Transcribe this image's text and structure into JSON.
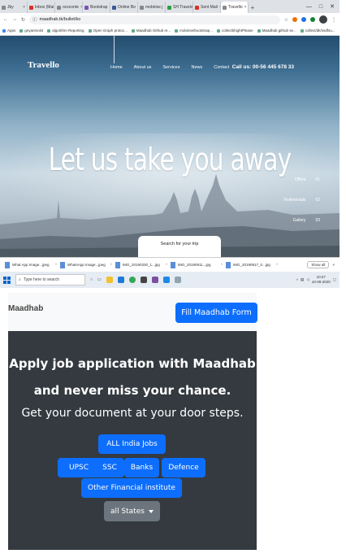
{
  "browser": {
    "tabs": [
      {
        "label": "Jby",
        "active": false
      },
      {
        "label": "Inbox (Mai",
        "active": false
      },
      {
        "label": "ocsconte",
        "active": false
      },
      {
        "label": "Bootstrap",
        "active": false
      },
      {
        "label": "Online Bo",
        "active": false
      },
      {
        "label": "mobirise j",
        "active": false
      },
      {
        "label": "SH Travels",
        "active": false
      },
      {
        "label": "Sent Mail",
        "active": false
      },
      {
        "label": "Travello",
        "active": true
      }
    ],
    "new_tab": "+",
    "window_controls": [
      "—",
      "□",
      "✕"
    ],
    "url": "maadhab.tk/bullet/ko",
    "bookmarks": [
      "Apps",
      "gnyanmoli4",
      "algorithm Reporting",
      "Open Graph protoc...",
      "Maadhab Github re...",
      "mobirise/bootstrap...",
      "collectbhightPlease",
      "Maadhab github se...",
      "collect/dk/ssdfsu..."
    ]
  },
  "site": {
    "brand": "Travello",
    "nav": [
      "Home",
      "About us",
      "Services",
      "News",
      "Contact"
    ],
    "phone": "Call us: 00-56 445 678 33",
    "hero_title": "Let us take you away",
    "stats": [
      {
        "label": "Offers",
        "value": "01"
      },
      {
        "label": "Testimonials",
        "value": "02"
      },
      {
        "label": "Gallery",
        "value": "03"
      }
    ],
    "search_tab": "Search for your trip"
  },
  "downloads": {
    "items": [
      "What App Image...jpeg",
      "WhatsApp Image...jpeg",
      "IMG_20190330_1...jpg",
      "IMG_20190911...jpg",
      "IMG_20190917_0...jpg"
    ],
    "show_all": "Show all"
  },
  "taskbar": {
    "search_placeholder": "Type here to search",
    "time": "10:27",
    "date": "10-09-2020"
  },
  "maadhab": {
    "brand": "Maadhab",
    "fill_form": "Fill Maadhab Form",
    "headline1": "Apply job application with Maadhab",
    "headline2": "and never miss your chance.",
    "subline": "Get your document at your door steps.",
    "buttons": {
      "all_india": "ALL India Jobs",
      "upsc": "UPSC",
      "ssc": "SSC",
      "banks": "Banks",
      "defence": "Defence",
      "other": "Other Financial institute",
      "states": "all States"
    }
  },
  "colors": {
    "primary": "#0d6efd",
    "secondary": "#6c757d",
    "panel": "#343a40",
    "navbar": "#f8f9fa"
  }
}
